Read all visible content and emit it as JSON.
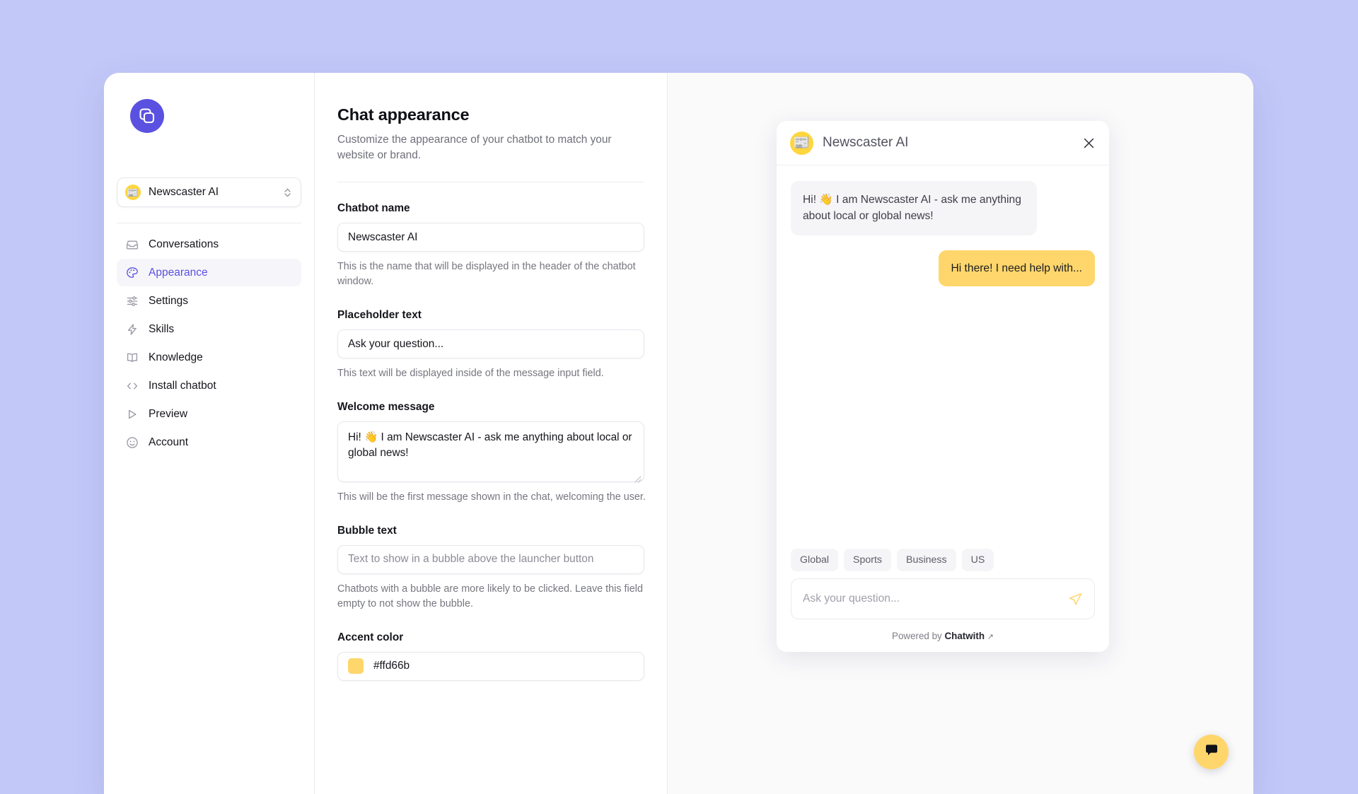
{
  "app": {
    "brand_icon": "stacked-squares-logo",
    "accent_brand_color": "#5b51e0",
    "background_color": "#c2c8f7"
  },
  "sidebar": {
    "workspace": {
      "avatar_icon": "newspaper-emoji",
      "name": "Newscaster AI",
      "chevron_icon": "chevron-up-down-icon"
    },
    "items": [
      {
        "label": "Conversations",
        "icon": "inbox-icon",
        "active": false
      },
      {
        "label": "Appearance",
        "icon": "palette-icon",
        "active": true
      },
      {
        "label": "Settings",
        "icon": "sliders-icon",
        "active": false
      },
      {
        "label": "Skills",
        "icon": "lightning-icon",
        "active": false
      },
      {
        "label": "Knowledge",
        "icon": "book-open-icon",
        "active": false
      },
      {
        "label": "Install chatbot",
        "icon": "code-brackets-icon",
        "active": false
      },
      {
        "label": "Preview",
        "icon": "play-triangle-icon",
        "active": false
      },
      {
        "label": "Account",
        "icon": "smiley-face-icon",
        "active": false
      }
    ]
  },
  "main": {
    "title": "Chat appearance",
    "subtitle": "Customize the appearance of your chatbot to match your website or brand.",
    "fields": [
      {
        "label": "Chatbot name",
        "value": "Newscaster AI",
        "placeholder": "",
        "help": "This is the name that will be displayed in the header of the chatbot window."
      },
      {
        "label": "Placeholder text",
        "value": "Ask your question...",
        "placeholder": "",
        "help": "This text will be displayed inside of the message input field."
      },
      {
        "label": "Welcome message",
        "value": "Hi! 👋 I am Newscaster AI - ask me anything about local or global news!",
        "placeholder": "",
        "help": "This will be the first message shown in the chat, welcoming the user."
      },
      {
        "label": "Bubble text",
        "value": "",
        "placeholder": "Text to show in a bubble above the launcher button",
        "help": "Chatbots with a bubble are more likely to be clicked. Leave this field empty to not show the bubble."
      },
      {
        "label": "Accent color",
        "value": "#ffd66b",
        "placeholder": "",
        "help": ""
      }
    ]
  },
  "preview": {
    "widget": {
      "avatar_icon": "newspaper-emoji",
      "title": "Newscaster AI",
      "close_icon": "close-x-icon",
      "messages": [
        {
          "role": "bot",
          "text": "Hi! 👋 I am Newscaster AI - ask me anything about local or global news!"
        },
        {
          "role": "user",
          "text": "Hi there! I need help with..."
        }
      ],
      "chips": [
        "Global",
        "Sports",
        "Business",
        "US"
      ],
      "input_placeholder": "Ask your question...",
      "send_icon": "send-paper-plane-icon",
      "footer_prefix": "Powered by",
      "footer_brand": "Chatwith",
      "footer_external_icon": "↗",
      "accent_color": "#ffd66b"
    },
    "launcher": {
      "icon": "chat-bubble-icon",
      "color": "#ffd66b"
    }
  }
}
